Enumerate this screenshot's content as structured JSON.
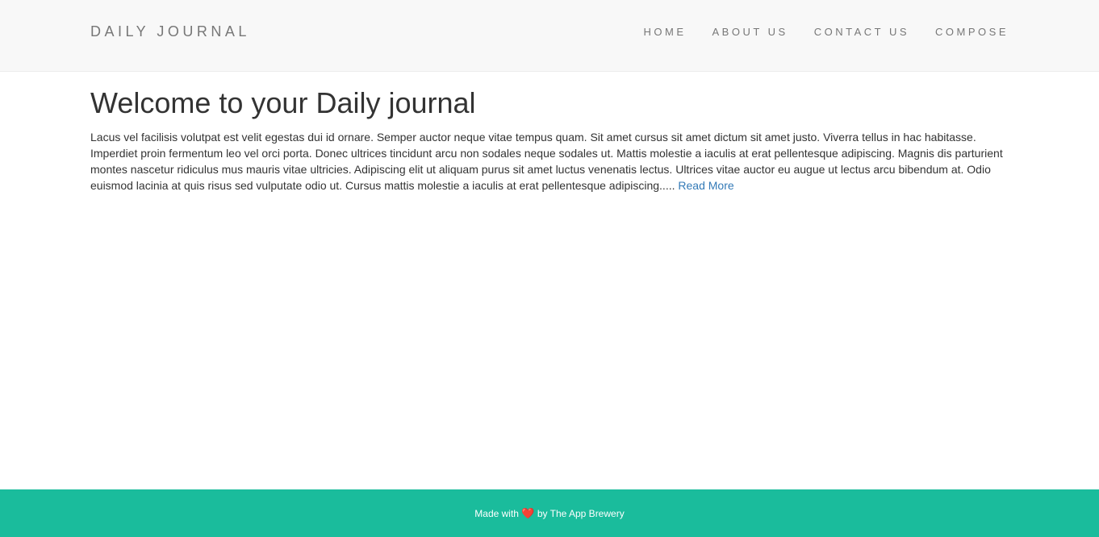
{
  "navbar": {
    "brand": "DAILY JOURNAL",
    "links": [
      {
        "label": "HOME"
      },
      {
        "label": "ABOUT US"
      },
      {
        "label": "CONTACT US"
      },
      {
        "label": "COMPOSE"
      }
    ]
  },
  "main": {
    "title": "Welcome to your Daily journal",
    "body": "Lacus vel facilisis volutpat est velit egestas dui id ornare. Semper auctor neque vitae tempus quam. Sit amet cursus sit amet dictum sit amet justo. Viverra tellus in hac habitasse. Imperdiet proin fermentum leo vel orci porta. Donec ultrices tincidunt arcu non sodales neque sodales ut. Mattis molestie a iaculis at erat pellentesque adipiscing. Magnis dis parturient montes nascetur ridiculus mus mauris vitae ultricies. Adipiscing elit ut aliquam purus sit amet luctus venenatis lectus. Ultrices vitae auctor eu augue ut lectus arcu bibendum at. Odio euismod lacinia at quis risus sed vulputate odio ut. Cursus mattis molestie a iaculis at erat pellentesque adipiscing.....",
    "read_more": "Read More"
  },
  "footer": {
    "prefix": "Made with",
    "heart_icon": "heart-icon",
    "heart_glyph": "❤️",
    "suffix": "by The App Brewery"
  },
  "colors": {
    "navbar_bg": "#f8f8f8",
    "footer_bg": "#1abc9c",
    "link": "#337ab7",
    "nav_text": "#777777"
  }
}
